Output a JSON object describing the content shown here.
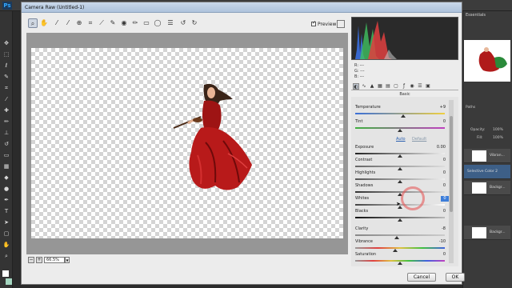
{
  "ps": {
    "logo": "Ps",
    "panel_label": "Essentials",
    "opacity_label": "Opacity:",
    "opacity_value": "100%",
    "fill_label": "Fill:",
    "fill_value": "100%",
    "paths_label": "Paths",
    "layers": [
      {
        "name": "Vibran..."
      },
      {
        "name": "Selective Color 2"
      },
      {
        "name": "Backgr..."
      },
      {
        "name": "Backgr..."
      }
    ]
  },
  "window": {
    "title": "Camera Raw (Untitled-1)"
  },
  "toolbar": {
    "preview_label": "Preview"
  },
  "zoom": {
    "value": "66.5%",
    "minus": "−",
    "plus": "+"
  },
  "readout": {
    "r": "R:  ---",
    "g": "G:  ---",
    "b": "B:  ---"
  },
  "panel": {
    "section_title": "Basic",
    "auto_label": "Auto",
    "default_label": "Default",
    "sliders": [
      {
        "label": "Temperature",
        "value": "+9"
      },
      {
        "label": "Tint",
        "value": "0"
      },
      {
        "label": "Exposure",
        "value": "0.00"
      },
      {
        "label": "Contrast",
        "value": "0"
      },
      {
        "label": "Highlights",
        "value": "0"
      },
      {
        "label": "Shadows",
        "value": "0"
      },
      {
        "label": "Whites",
        "value": "0"
      },
      {
        "label": "Blacks",
        "value": "0"
      },
      {
        "label": "Clarity",
        "value": "-8"
      },
      {
        "label": "Vibrance",
        "value": "-10"
      },
      {
        "label": "Saturation",
        "value": "0"
      }
    ]
  },
  "buttons": {
    "cancel": "Cancel",
    "ok": "OK"
  },
  "colors": {
    "accent": "#3c7dd9",
    "dress": "#b01a1a",
    "highlight_ring": "#e65a5a"
  },
  "icons": [
    "zoom-icon",
    "hand-icon",
    "white-balance-icon",
    "color-sampler-icon",
    "target-adjust-icon",
    "crop-icon",
    "straighten-icon",
    "spot-removal-icon",
    "red-eye-icon",
    "adjustment-brush-icon",
    "graduated-filter-icon",
    "radial-filter-icon",
    "preferences-icon",
    "rotate-left-icon",
    "rotate-right-icon"
  ]
}
